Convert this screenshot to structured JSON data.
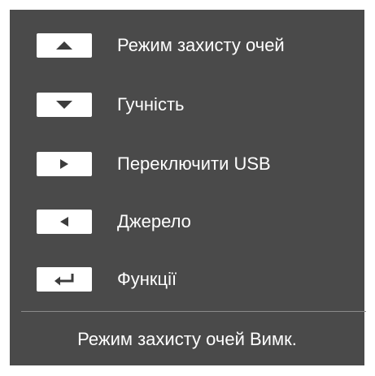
{
  "menu": {
    "items": [
      {
        "icon": "arrow-up-icon",
        "label": "Режим захисту очей"
      },
      {
        "icon": "arrow-down-icon",
        "label": "Гучність"
      },
      {
        "icon": "arrow-right-icon",
        "label": "Переключити USB"
      },
      {
        "icon": "arrow-left-icon",
        "label": "Джерело"
      },
      {
        "icon": "enter-return-icon",
        "label": "Функції"
      }
    ]
  },
  "status": {
    "text": "Режим захисту очей Вимк."
  },
  "colors": {
    "panel_background": "#4a4a4a",
    "key_background": "#ffffff",
    "icon": "#3c3c3c",
    "text": "#ffffff",
    "divider": "#8a8a8a"
  }
}
